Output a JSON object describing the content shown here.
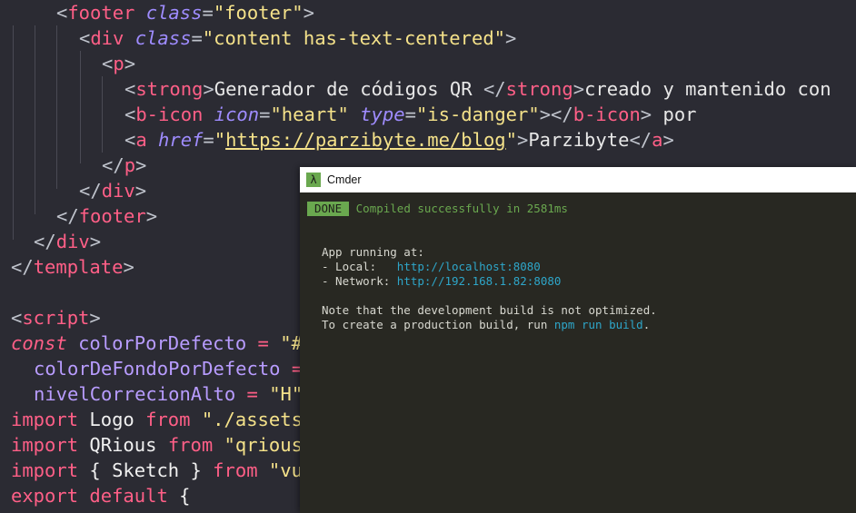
{
  "editor": {
    "lines": {
      "l1": {
        "open": "<",
        "tag": "footer",
        "attr": "class",
        "eq": "=",
        "val": "\"footer\"",
        "close": ">"
      },
      "l2": {
        "open": "<",
        "tag": "div",
        "attr": "class",
        "eq": "=",
        "val": "\"content has-text-centered\"",
        "close": ">"
      },
      "l3": {
        "open": "<",
        "tag": "p",
        "close": ">"
      },
      "l4": {
        "open": "<",
        "tag": "strong",
        "close": ">",
        "text": "Generador de códigos QR ",
        "end_open": "</",
        "end_tag": "strong",
        "end_close": ">",
        "text2": "creado y mantenido con"
      },
      "l5": {
        "open": "<",
        "tag": "b-icon",
        "attr1": "icon",
        "eq1": "=",
        "val1": "\"heart\"",
        "attr2": "type",
        "eq2": "=",
        "val2": "\"is-danger\"",
        "close": ">",
        "end_open": "</",
        "end_tag": "b-icon",
        "end_close": ">",
        "text": " por"
      },
      "l6": {
        "open": "<",
        "tag": "a",
        "attr": "href",
        "eq": "=",
        "q1": "\"",
        "url": "https://parzibyte.me/blog",
        "q2": "\"",
        "close": ">",
        "text": "Parzibyte",
        "end_open": "</",
        "end_tag": "a",
        "end_close": ">"
      },
      "l7": {
        "open": "</",
        "tag": "p",
        "close": ">"
      },
      "l8": {
        "open": "</",
        "tag": "div",
        "close": ">"
      },
      "l9": {
        "open": "</",
        "tag": "footer",
        "close": ">"
      },
      "l10": {
        "open": "</",
        "tag": "div",
        "close": ">"
      },
      "l11": {
        "open": "</",
        "tag": "template",
        "close": ">"
      },
      "l13": {
        "open": "<",
        "tag": "script",
        "close": ">"
      },
      "l14": {
        "kw": "const",
        "var": "colorPorDefecto",
        "op": "=",
        "rest": "\"#"
      },
      "l15": {
        "var": "colorDeFondoPorDefecto",
        "op": "="
      },
      "l16": {
        "var": "nivelCorrecionAlto",
        "op": "=",
        "rest": "\"H\""
      },
      "l17": {
        "kw": "import",
        "name": "Logo",
        "kw2": "from",
        "rest": "\"./assets"
      },
      "l18": {
        "kw": "import",
        "name": "QRious",
        "kw2": "from",
        "rest": "\"qrious"
      },
      "l19": {
        "kw": "import",
        "name": "{ Sketch }",
        "kw2": "from",
        "rest": "\"vu"
      },
      "l20": {
        "kw": "export",
        "kw2": "default",
        "rest": "{"
      }
    }
  },
  "cmder": {
    "title": "Cmder",
    "icon": "lambda-icon",
    "icon_glyph": "λ",
    "done_badge": "DONE",
    "compiled_msg": "Compiled successfully in 2581ms",
    "app_running": "App running at:",
    "local_label": "- Local:   ",
    "local_url": "http://localhost:",
    "local_port": "8080",
    "network_label": "- Network: ",
    "network_url": "http://192.168.1.82:",
    "network_port": "8080",
    "note1": "Note that the development build is not optimized.",
    "note2_prefix": "To create a production build, run ",
    "note2_cmd": "npm run build",
    "note2_suffix": "."
  },
  "colors": {
    "editor_bg": "#2b2b33",
    "tag": "#ff5f87",
    "attr": "#9f8cff",
    "string": "#f5e28a",
    "terminal_bg": "#282822",
    "done_green": "#6aa84f",
    "link_cyan": "#2ea6c9"
  }
}
